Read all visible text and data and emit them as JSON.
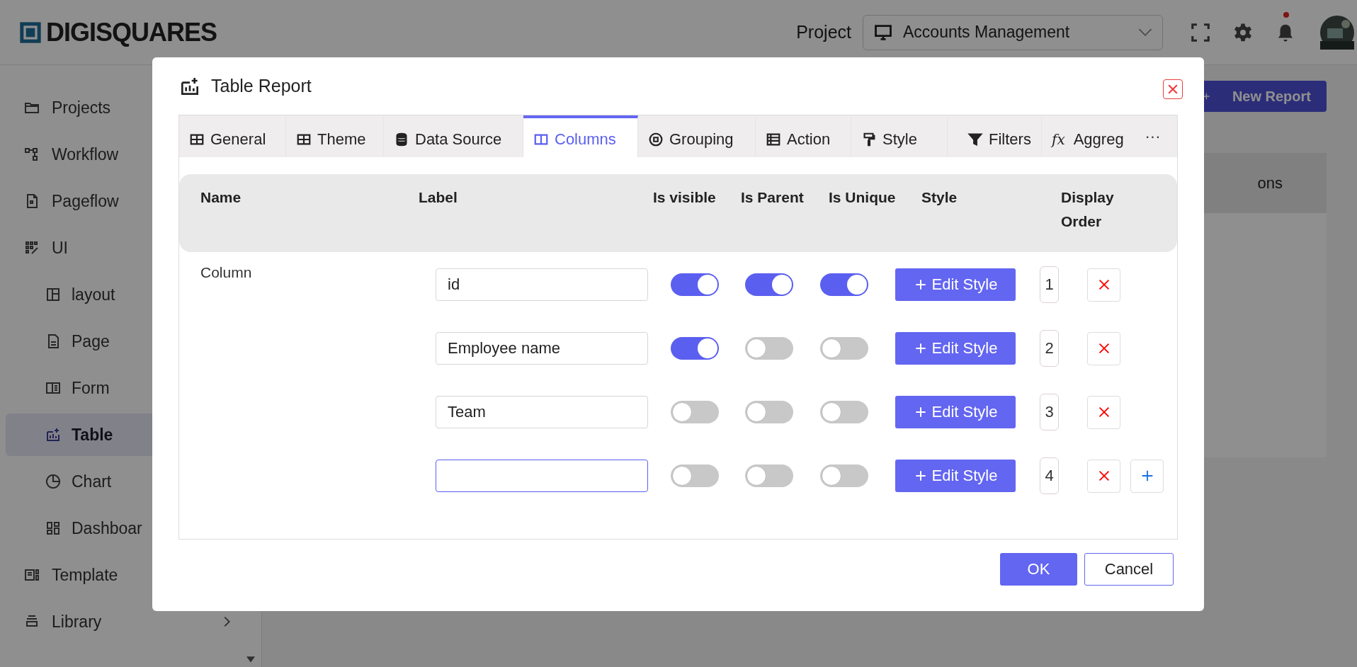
{
  "header": {
    "logo": "DIGISQUARES",
    "project_label": "Project",
    "project": "Accounts Management",
    "notification_dot": true
  },
  "sidebar": {
    "items": [
      {
        "label": "Projects",
        "selected": false
      },
      {
        "label": "Workflow",
        "selected": false
      },
      {
        "label": "Pageflow",
        "selected": false
      },
      {
        "label": "UI",
        "selected": false,
        "children": [
          {
            "label": "layout",
            "selected": false
          },
          {
            "label": "Page",
            "selected": false
          },
          {
            "label": "Form",
            "selected": false
          },
          {
            "label": "Table",
            "selected": true
          },
          {
            "label": "Chart",
            "selected": false
          },
          {
            "label": "Dashboar",
            "selected": false
          }
        ]
      },
      {
        "label": "Template",
        "selected": false
      },
      {
        "label": "Library",
        "selected": false,
        "expandable": true
      }
    ]
  },
  "page": {
    "new_report": "New Report",
    "table_heading": "ons"
  },
  "dialog": {
    "title": "Table Report",
    "tabs": [
      {
        "label": "General",
        "selected": false
      },
      {
        "label": "Theme",
        "selected": false
      },
      {
        "label": "Data Source",
        "selected": false
      },
      {
        "label": "Columns",
        "selected": true
      },
      {
        "label": "Grouping",
        "selected": false
      },
      {
        "label": "Action",
        "selected": false
      },
      {
        "label": "Style",
        "selected": false
      },
      {
        "label": "Filters",
        "selected": false
      },
      {
        "label": "Aggreg",
        "selected": false,
        "glyph": "fx"
      }
    ],
    "more": "···",
    "columns": [
      "Name",
      "Label",
      "Is visible",
      "Is Parent",
      "Is Unique",
      "Style",
      "Display Order"
    ],
    "group_label": "Column",
    "rows": [
      {
        "label": "id",
        "visible": true,
        "parent": true,
        "unique": true,
        "style_button": "Edit Style",
        "order": "1",
        "focused": false,
        "addable": false
      },
      {
        "label": "Employee name",
        "visible": true,
        "parent": false,
        "unique": false,
        "style_button": "Edit Style",
        "order": "2",
        "focused": false,
        "addable": false
      },
      {
        "label": "Team",
        "visible": false,
        "parent": false,
        "unique": false,
        "style_button": "Edit Style",
        "order": "3",
        "focused": false,
        "addable": false
      },
      {
        "label": "",
        "visible": false,
        "parent": false,
        "unique": false,
        "style_button": "Edit Style",
        "order": "4",
        "focused": true,
        "addable": true
      }
    ],
    "buttons": {
      "ok": "OK",
      "cancel": "Cancel"
    }
  }
}
